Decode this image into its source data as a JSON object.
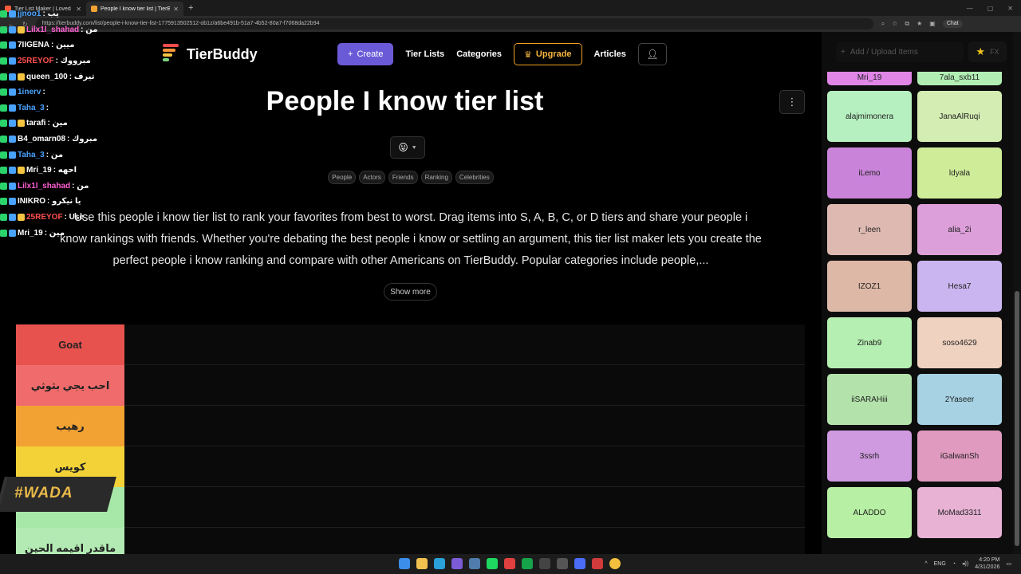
{
  "browser": {
    "tabs": [
      {
        "label": "Tier List Maker | Loved by YouTube...",
        "active": false
      },
      {
        "label": "People I know tier list | TierBuddy",
        "active": true
      }
    ],
    "url": "https://tierbuddy.com/list/people-i-know-tier-list-1775913502512-ob1z/a6be491b-51a7-4b52-80a7-f7068da22b94",
    "chat_button": "Chat"
  },
  "header": {
    "logo_text": "TierBuddy",
    "nav": {
      "create": "Create",
      "tier_lists": "Tier Lists",
      "categories": "Categories",
      "upgrade": "Upgrade",
      "articles": "Articles"
    }
  },
  "main": {
    "title": "People I know tier list",
    "emoji": "😛",
    "tags": [
      "People",
      "Actors",
      "Friends",
      "Ranking",
      "Celebrities"
    ],
    "description": "Use this people i know tier list to rank your favorites from best to worst. Drag items into S, A, B, C, or D tiers and share your people i know rankings with friends. Whether you're debating the best people i know or settling an argument, this tier list maker lets you create the perfect people i know ranking and compare with other Americans on TierBuddy. Popular categories include people,...",
    "show_more": "Show more"
  },
  "tiers": [
    {
      "label": "Goat",
      "color": "#e8524e"
    },
    {
      "label": "احب يجي بثوثي",
      "color": "#f06b6b"
    },
    {
      "label": "رهيب",
      "color": "#f2a233"
    },
    {
      "label": "كويس",
      "color": "#f3d238"
    },
    {
      "label": "",
      "color": "#a7e8a8"
    },
    {
      "label": "ماقدر اقيمه الحين",
      "color": "#b3eab3"
    }
  ],
  "side_panel": {
    "add_placeholder": "Add / Upload Items",
    "fx_label": "FX",
    "items": [
      {
        "name": "Mri_19",
        "color": "#df86e6",
        "partial": true
      },
      {
        "name": "7ala_sxb11",
        "color": "#b1eeb4",
        "partial": true
      },
      {
        "name": "alajmimonera",
        "color": "#b7f0c0"
      },
      {
        "name": "JanaAlRuqi",
        "color": "#d4edb3"
      },
      {
        "name": "iLemo",
        "color": "#c983d9"
      },
      {
        "name": "ldyala",
        "color": "#cfed99"
      },
      {
        "name": "r_leen",
        "color": "#deb9b1"
      },
      {
        "name": "alia_2i",
        "color": "#dd9fda"
      },
      {
        "name": "IZOZ1",
        "color": "#deb8a7"
      },
      {
        "name": "Hesa7",
        "color": "#cbb5f0"
      },
      {
        "name": "Zinab9",
        "color": "#b6efb2"
      },
      {
        "name": "soso4629",
        "color": "#f0d2c0"
      },
      {
        "name": "iiSARAHiii",
        "color": "#b3e3ab"
      },
      {
        "name": "2Yaseer",
        "color": "#a6d2e4"
      },
      {
        "name": "3ssrh",
        "color": "#cf9ae0"
      },
      {
        "name": "iGalwanSh",
        "color": "#e09abf"
      },
      {
        "name": "ALADDO",
        "color": "#b7f0a4"
      },
      {
        "name": "MoMad3311",
        "color": "#e8b2d5"
      }
    ]
  },
  "chat": [
    {
      "name": "jjnoo1",
      "text": ": يب",
      "color": "#4aa3ff"
    },
    {
      "name": "Lilx1l_shahad",
      "text": ": من",
      "color": "#ff5ed2"
    },
    {
      "name": "7IIGENA",
      "text": ": ميين",
      "color": "#ffffff"
    },
    {
      "name": "25REYOF",
      "text": ": مبرووك",
      "color": "#ff4f4f"
    },
    {
      "name": "queen_100",
      "text": ": تيرف",
      "color": "#ffffff"
    },
    {
      "name": "1inerv",
      "text": ":",
      "color": "#4aa3ff"
    },
    {
      "name": "Taha_3",
      "text": ":",
      "color": "#4aa3ff"
    },
    {
      "name": "tarafi",
      "text": ": مين",
      "color": "#ffffff"
    },
    {
      "name": "B4_omarn08",
      "text": ": مبروك",
      "color": "#ffffff"
    },
    {
      "name": "Taha_3",
      "text": ": من",
      "color": "#4aa3ff"
    },
    {
      "name": "Mri_19",
      "text": ": احهه",
      "color": "#ffffff"
    },
    {
      "name": "Lilx1l_shahad",
      "text": ": من",
      "color": "#ff5ed2"
    },
    {
      "name": "INIKRO",
      "text": ": يا نيكرو",
      "color": "#ffffff"
    },
    {
      "name": "25REYOF",
      "text": ": Use",
      "color": "#ff4f4f"
    },
    {
      "name": "Mri_19",
      "text": ": مين",
      "color": "#ffffff"
    }
  ],
  "stream_logo": "#WADA",
  "taskbar": {
    "lang": "ENG",
    "time": "4:20 PM",
    "date": "4/31/2026"
  }
}
